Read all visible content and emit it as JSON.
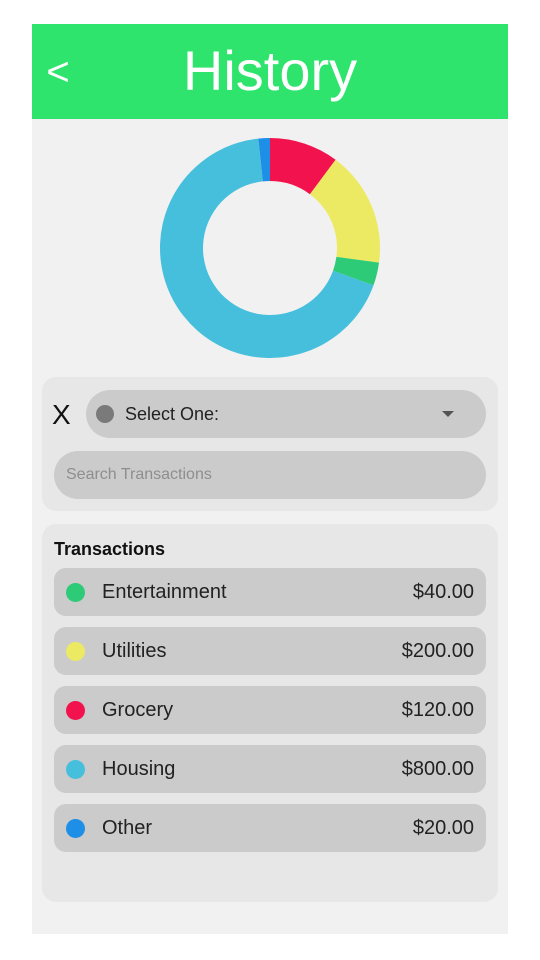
{
  "header": {
    "back_label": "<",
    "title": "History",
    "color": "#2ee46d"
  },
  "chart_data": {
    "type": "pie",
    "categories": [
      "Grocery",
      "Utilities",
      "Entertainment",
      "Housing",
      "Other"
    ],
    "values": [
      120,
      200,
      40,
      800,
      20
    ],
    "colors": [
      "#f2124d",
      "#ecea63",
      "#2dcb78",
      "#46bfdd",
      "#1d8fe6"
    ],
    "donut": true
  },
  "filter": {
    "clear_label": "X",
    "select_value": "Select One:",
    "search_placeholder": "Search Transactions",
    "search_value": ""
  },
  "transactions": {
    "heading": "Transactions",
    "items": [
      {
        "name": "Entertainment",
        "amount": "$40.00",
        "color": "#2dcb78"
      },
      {
        "name": "Utilities",
        "amount": "$200.00",
        "color": "#ecea63"
      },
      {
        "name": "Grocery",
        "amount": "$120.00",
        "color": "#f2124d"
      },
      {
        "name": "Housing",
        "amount": "$800.00",
        "color": "#46bfdd"
      },
      {
        "name": "Other",
        "amount": "$20.00",
        "color": "#1d8fe6"
      }
    ]
  }
}
